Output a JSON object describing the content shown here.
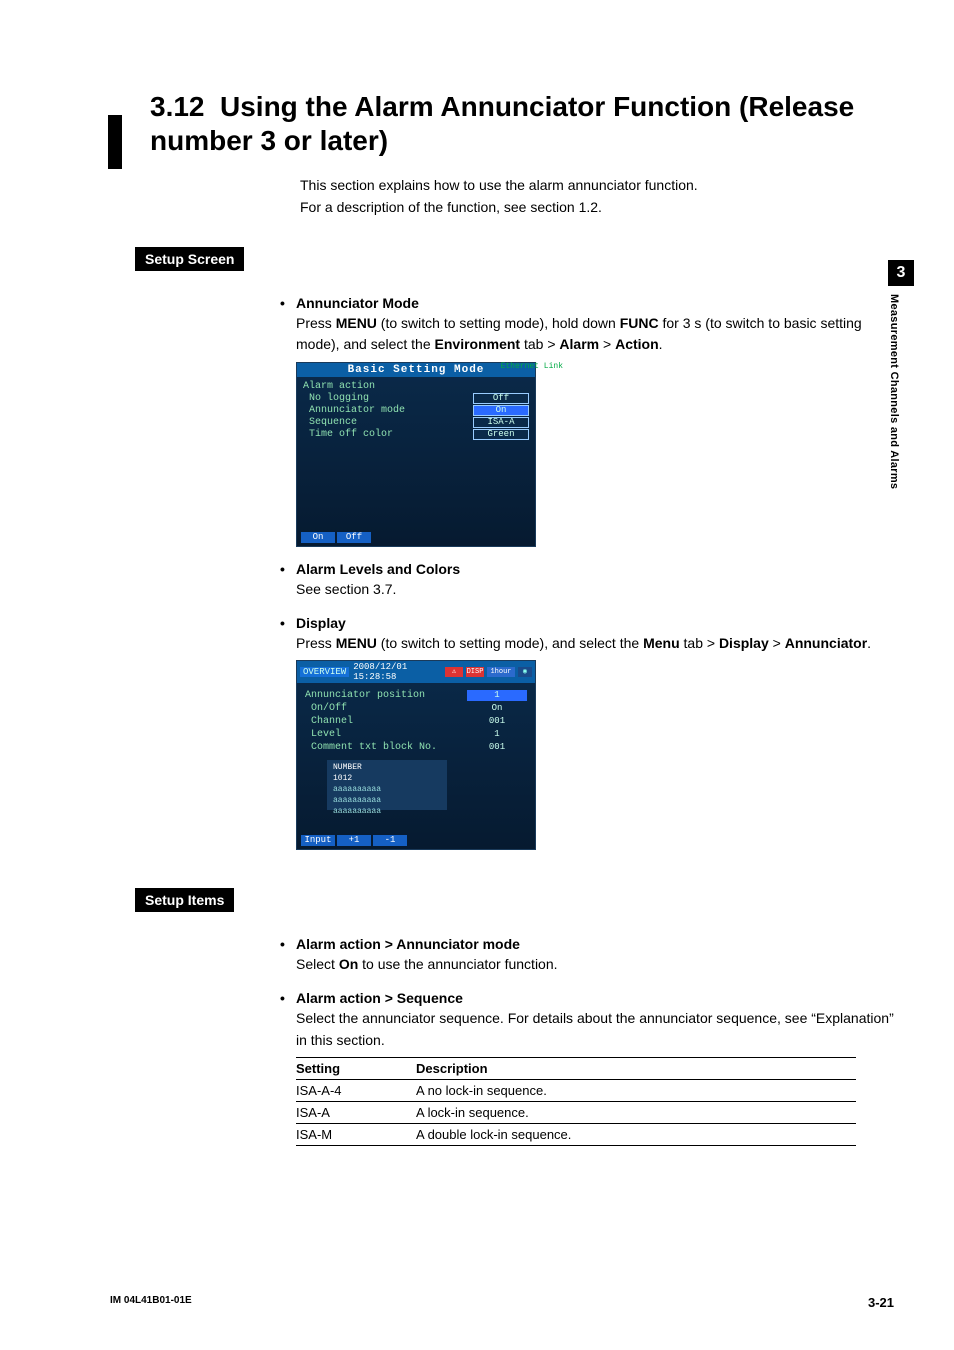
{
  "section": {
    "number": "3.12",
    "title": "Using the Alarm Annunciator Function (Release number 3 or later)"
  },
  "intro": {
    "line1": "This section explains how to use the alarm annunciator function.",
    "line2": "For a description of the function, see section 1.2."
  },
  "label_setup_screen": "Setup Screen",
  "label_setup_items": "Setup Items",
  "annunciator_mode": {
    "heading": "Annunciator Mode",
    "press": "Press ",
    "menu": "MENU",
    "mid1": " (to switch to setting mode), hold down ",
    "func": "FUNC",
    "mid2": " for 3 s (to switch to basic setting mode), and select the ",
    "env": "Environment",
    "gt1": " tab > ",
    "alarm": "Alarm",
    "gt2": " > ",
    "action": "Action",
    "dot": "."
  },
  "dev1": {
    "title": "Basic Setting Mode",
    "eth": "Ethernet\nLink",
    "rows": [
      {
        "label": "Alarm action",
        "value": ""
      },
      {
        "label": "No logging",
        "value": "Off"
      },
      {
        "label": "Annunciator mode",
        "value": "On",
        "sel": true
      },
      {
        "label": "Sequence",
        "value": "ISA-A"
      },
      {
        "label": "Time off color",
        "value": "Green"
      }
    ],
    "softkeys": [
      "On",
      "Off"
    ]
  },
  "alarm_levels": {
    "heading": "Alarm Levels and Colors",
    "text": "See section 3.7."
  },
  "display": {
    "heading": "Display",
    "press": "Press ",
    "menu": "MENU",
    "mid1": " (to switch to setting mode), and select the ",
    "menutab": "Menu",
    "gt1": " tab > ",
    "disp": "Display",
    "gt2": " > ",
    "ann": "Annunciator",
    "dot": "."
  },
  "dev2": {
    "overview": "OVERVIEW",
    "date": "2008/12/01 15:28:58",
    "disp_icon": "DISP",
    "hour": "1hour",
    "rows": [
      {
        "label": "Annunciator position",
        "value": "1",
        "sel": true
      },
      {
        "label": "On/Off",
        "value": "On"
      },
      {
        "label": "Channel",
        "value": "001"
      },
      {
        "label": "Level",
        "value": "1"
      },
      {
        "label": "Comment txt block No.",
        "value": "001"
      }
    ],
    "preview": {
      "l1": "NUMBER",
      "l2": "1012",
      "l3": "aaaaaaaaaa",
      "l4": "aaaaaaaaaa",
      "l5": "aaaaaaaaaa"
    },
    "softkeys": [
      "Input",
      "+1",
      "-1"
    ]
  },
  "item1": {
    "heading": "Alarm action > Annunciator mode",
    "pre": "Select ",
    "on": "On",
    "post": " to use the annunciator function."
  },
  "item2": {
    "heading": "Alarm action > Sequence",
    "text": "Select the annunciator sequence. For details about the annunciator sequence, see “Explanation” in this section."
  },
  "table": {
    "h1": "Setting",
    "h2": "Description",
    "rows": [
      {
        "s": "ISA-A-4",
        "d": "A no lock-in sequence."
      },
      {
        "s": "ISA-A",
        "d": "A lock-in sequence."
      },
      {
        "s": "ISA-M",
        "d": "A double lock-in sequence."
      }
    ]
  },
  "sidetab": {
    "num": "3",
    "text": "Measurement Channels and Alarms"
  },
  "footer": {
    "doc": "IM 04L41B01-01E",
    "page": "3-21"
  }
}
